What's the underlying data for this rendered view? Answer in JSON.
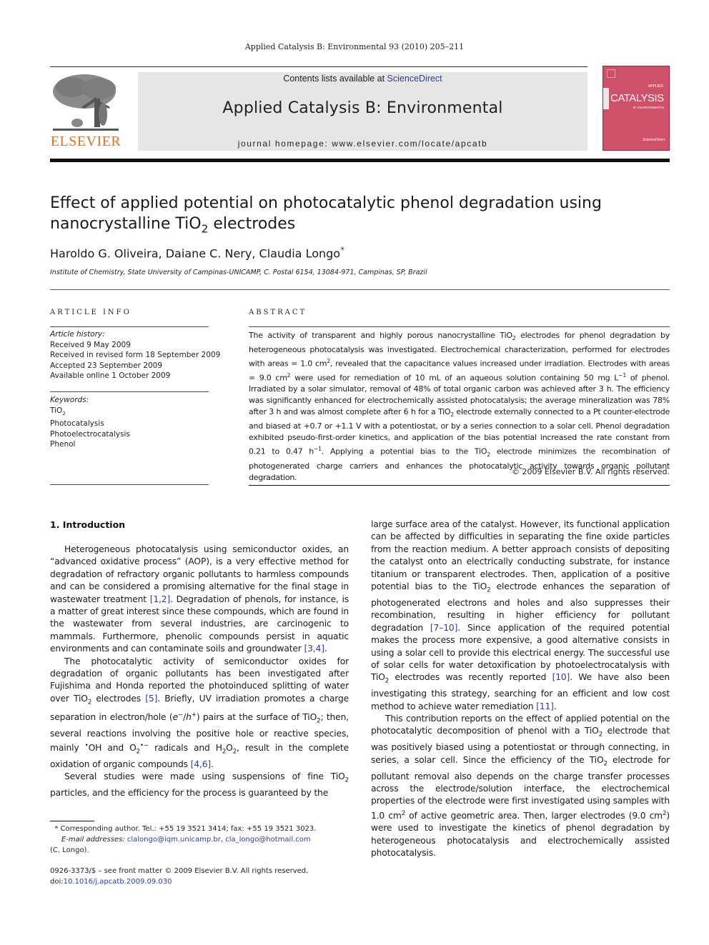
{
  "header": {
    "citation": "Applied Catalysis B: Environmental 93 (2010) 205–211",
    "contents_prefix": "Contents lists available at ",
    "contents_link": "ScienceDirect",
    "journal_title": "Applied Catalysis B: Environmental",
    "homepage": "journal homepage: www.elsevier.com/locate/apcatb",
    "publisher_logo_text": "ELSEVIER",
    "cover": {
      "applied": "APPLIED",
      "catalysis": "CATALYSIS",
      "subtitle": "B: ENVIRONMENTAL",
      "sciencedirect": "ScienceDirect"
    },
    "colors": {
      "elsevier_orange": "#e9711c",
      "cover_pink": "#cf5169",
      "link_blue": "#2a3e9c",
      "masthead_gray": "#e6e6e6"
    }
  },
  "article": {
    "title_line1": "Effect of applied potential on photocatalytic phenol degradation using",
    "title_line2_pre": "nanocrystalline TiO",
    "title_line2_sub": "2",
    "title_line2_post": " electrodes",
    "authors": "Haroldo G. Oliveira, Daiane C. Nery, Claudia Longo",
    "corresponding_mark": "*",
    "affiliation": "Institute of Chemistry, State University of Campinas-UNICAMP, C. Postal 6154, 13084-971, Campinas, SP, Brazil"
  },
  "article_info": {
    "label": "ARTICLE INFO",
    "history_label": "Article history:",
    "history": [
      "Received 9 May 2009",
      "Received in revised form 18 September 2009",
      "Accepted 23 September 2009",
      "Available online 1 October 2009"
    ],
    "keywords_label": "Keywords:",
    "keywords": [
      "TiO2",
      "Photocatalysis",
      "Photoelectrocatalysis",
      "Phenol"
    ]
  },
  "abstract": {
    "label": "ABSTRACT",
    "text": [
      "The activity of transparent and highly porous nanocrystalline TiO",
      "2",
      " electrodes for phenol degradation by heterogeneous photocatalysis was investigated. Electrochemical characterization, performed for electrodes with areas = 1.0 cm",
      "2",
      ", revealed that the capacitance values increased under irradiation. Electrodes with areas = 9.0 cm",
      "2",
      " were used for remediation of 10 mL of an aqueous solution containing 50 mg L",
      "−1",
      " of phenol. Irradiated by a solar simulator, removal of 48% of total organic carbon was achieved after 3 h. The efficiency was significantly enhanced for electrochemically assisted photocatalysis; the average mineralization was 78% after 3 h and was almost complete after 6 h for a TiO",
      "2",
      " electrode externally connected to a Pt counter-electrode and biased at +0.7 or +1.1 V with a potentiostat, or by a series connection to a solar cell. Phenol degradation exhibited pseudo-first-order kinetics, and application of the bias potential increased the rate constant from 0.21 to 0.47 h",
      "−1",
      ". Applying a potential bias to the TiO",
      "2",
      " electrode minimizes the recombination of photogenerated charge carriers and enhances the photocatalytic activity towards organic pollutant degradation."
    ],
    "copyright": "© 2009 Elsevier B.V. All rights reserved."
  },
  "introduction": {
    "heading": "1.  Introduction",
    "p1": [
      "Heterogeneous photocatalysis using semiconductor oxides, an “advanced oxidative process” (AOP), is a very effective method for degradation of refractory organic pollutants to harmless compounds and can be considered a promising alternative for the final stage in wastewater treatment ",
      "[1,2]",
      ". Degradation of phenols, for instance, is a matter of great interest since these compounds, which are found in the wastewater from several industries, are carcinogenic to mammals. Furthermore, phenolic compounds persist in aquatic environments and can contaminate soils and groundwater ",
      "[3,4]",
      "."
    ],
    "p2": [
      "The photocatalytic activity of semiconductor oxides for degradation of organic pollutants has been investigated after Fujishima and Honda reported the photoinduced splitting of water over TiO",
      "2",
      " electrodes ",
      "[5]",
      ". Briefly, UV irradiation promotes a charge separation in electron/hole (",
      "e",
      "−",
      "/",
      "h",
      "+",
      ") pairs at the surface of TiO",
      "2",
      "; then, several reactions involving the positive hole or reactive species, mainly ",
      "•",
      "OH and O",
      "2",
      "•−",
      " radicals and H",
      "2",
      "O",
      "2",
      ", result in the complete oxidation of organic compounds ",
      "[4,6]",
      "."
    ],
    "p3": [
      "Several studies were made using suspensions of fine TiO",
      "2",
      " particles, and the efficiency for the process is guaranteed by the"
    ],
    "right_p1": [
      "large surface area of the catalyst. However, its functional application can be affected by difficulties in separating the fine oxide particles from the reaction medium. A better approach consists of depositing the catalyst onto an electrically conducting substrate, for instance titanium or transparent electrodes. Then, application of a positive potential bias to the TiO",
      "2",
      " electrode enhances the separation of photogenerated electrons and holes and also suppresses their recombination, resulting in higher efficiency for pollutant degradation ",
      "[7–10]",
      ". Since application of the required potential makes the process more expensive, a good alternative consists in using a solar cell to provide this electrical energy. The successful use of solar cells for water detoxification by photoelectrocatalysis with TiO",
      "2",
      " electrodes was recently reported ",
      "[10]",
      ". We have also been investigating this strategy, searching for an efficient and low cost method to achieve water remediation ",
      "[11]",
      "."
    ],
    "right_p2": [
      "This contribution reports on the effect of applied potential on the photocatalytic decomposition of phenol with a TiO",
      "2",
      " electrode that was positively biased using a potentiostat or through connecting, in series, a solar cell. Since the efficiency of the TiO",
      "2",
      " electrode for pollutant removal also depends on the charge transfer processes across the electrode/solution interface, the electrochemical properties of the electrode were first investigated using samples with 1.0 cm",
      "2",
      " of active geometric area. Then, larger electrodes (9.0 cm",
      "2",
      ") were used to investigate the kinetics of phenol degradation by heterogeneous photocatalysis and electrochemically assisted photocatalysis."
    ]
  },
  "footnote": {
    "mark": "*",
    "corresponding": "Corresponding author. Tel.: +55 19 3521 3414; fax: +55 19 3521 3023.",
    "email_label": "E-mail addresses:",
    "email1": "clalongo@iqm.unicamp.br",
    "sep": ", ",
    "email2": "cla_longo@hotmail.com",
    "name": "(C. Longo)."
  },
  "front_matter": {
    "issn_line": "0926-3373/$ – see front matter © 2009 Elsevier B.V. All rights reserved.",
    "doi_prefix": "doi:",
    "doi": "10.1016/j.apcatb.2009.09.030"
  }
}
